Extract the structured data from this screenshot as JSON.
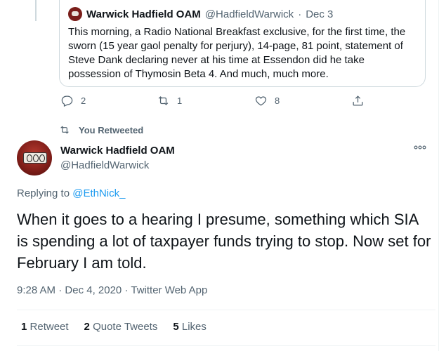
{
  "quoted_tweet": {
    "author_name": "Warwick Hadfield OAM",
    "author_handle": "@HadfieldWarwick",
    "separator": "·",
    "date": "Dec 3",
    "text": "This morning, a Radio National Breakfast exclusive, for the first time, the sworn (15 year gaol penalty for perjury), 14-page, 81 point, statement of Steve Dank declaring never at his time at Essendon did he take possession of Thymosin Beta 4. And much, much more.",
    "actions": {
      "reply_count": "2",
      "retweet_count": "1",
      "like_count": "8"
    }
  },
  "retweet_notice": "You Retweeted",
  "main_tweet": {
    "author_name": "Warwick Hadfield OAM",
    "author_handle": "@HadfieldWarwick",
    "replying_prefix": "Replying to",
    "replying_to": "@EthNick_",
    "text": "When it goes to a hearing I presume, something which SIA is spending a lot of taxpayer funds trying to stop. Now set for February I am told.",
    "time": "9:28 AM",
    "date": "Dec 4, 2020",
    "source": "Twitter Web App",
    "separator": "·",
    "stats": [
      {
        "count": "1",
        "label": "Retweet"
      },
      {
        "count": "2",
        "label": "Quote Tweets"
      },
      {
        "count": "5",
        "label": "Likes"
      }
    ]
  },
  "colors": {
    "text": "#0f1419",
    "secondary": "#536471",
    "link": "#1d9bf0",
    "border": "#cfd9de"
  },
  "icons": [
    "reply-icon",
    "retweet-icon",
    "like-icon",
    "share-icon",
    "more-icon",
    "avatar-image"
  ]
}
